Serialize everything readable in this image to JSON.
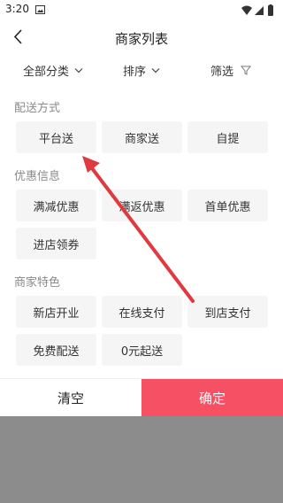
{
  "status_bar": {
    "time": "3:20"
  },
  "header": {
    "title": "商家列表"
  },
  "filter_bar": {
    "category_label": "全部分类",
    "sort_label": "排序",
    "filter_label": "筛选"
  },
  "sections": [
    {
      "title": "配送方式",
      "options": [
        "平台送",
        "商家送",
        "自提"
      ]
    },
    {
      "title": "优惠信息",
      "options": [
        "满减优惠",
        "满返优惠",
        "首单优惠",
        "进店领券"
      ]
    },
    {
      "title": "商家特色",
      "options": [
        "新店开业",
        "在线支付",
        "到店支付",
        "免费配送",
        "0元起送"
      ]
    }
  ],
  "footer": {
    "clear_label": "清空",
    "confirm_label": "确定"
  },
  "colors": {
    "accent": "#f55064",
    "annotation_arrow": "#e0393f",
    "option_bg": "#f5f5f5"
  }
}
